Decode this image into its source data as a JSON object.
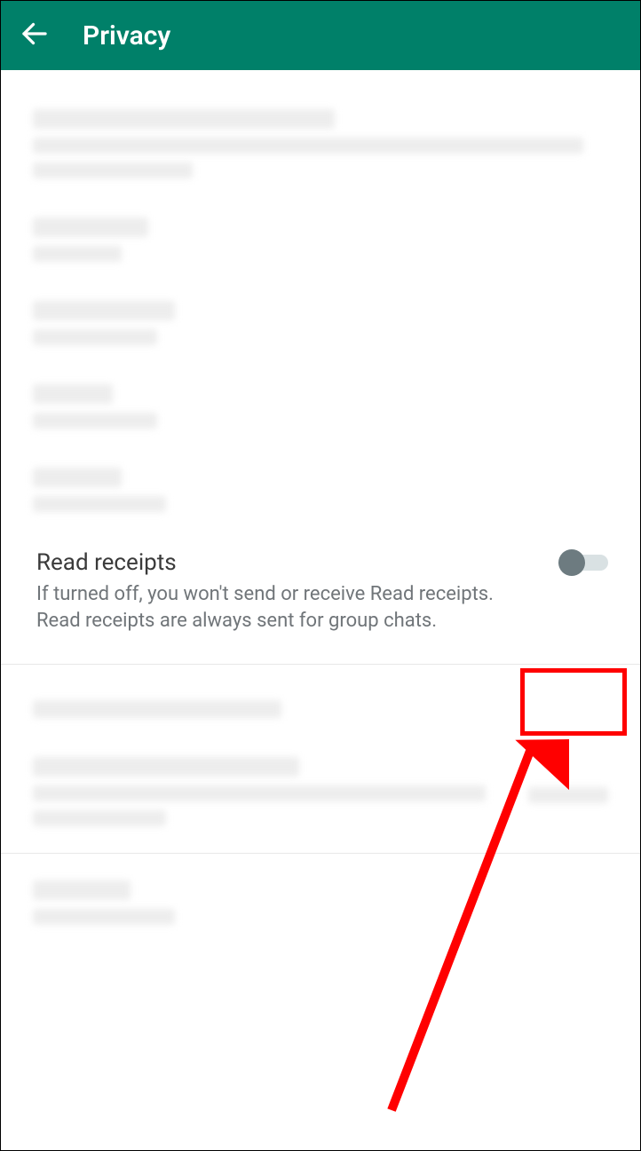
{
  "header": {
    "title": "Privacy"
  },
  "read_receipts": {
    "title": "Read receipts",
    "description": "If turned off, you won't send or receive Read receipts. Read receipts are always sent for group chats.",
    "enabled": false
  }
}
